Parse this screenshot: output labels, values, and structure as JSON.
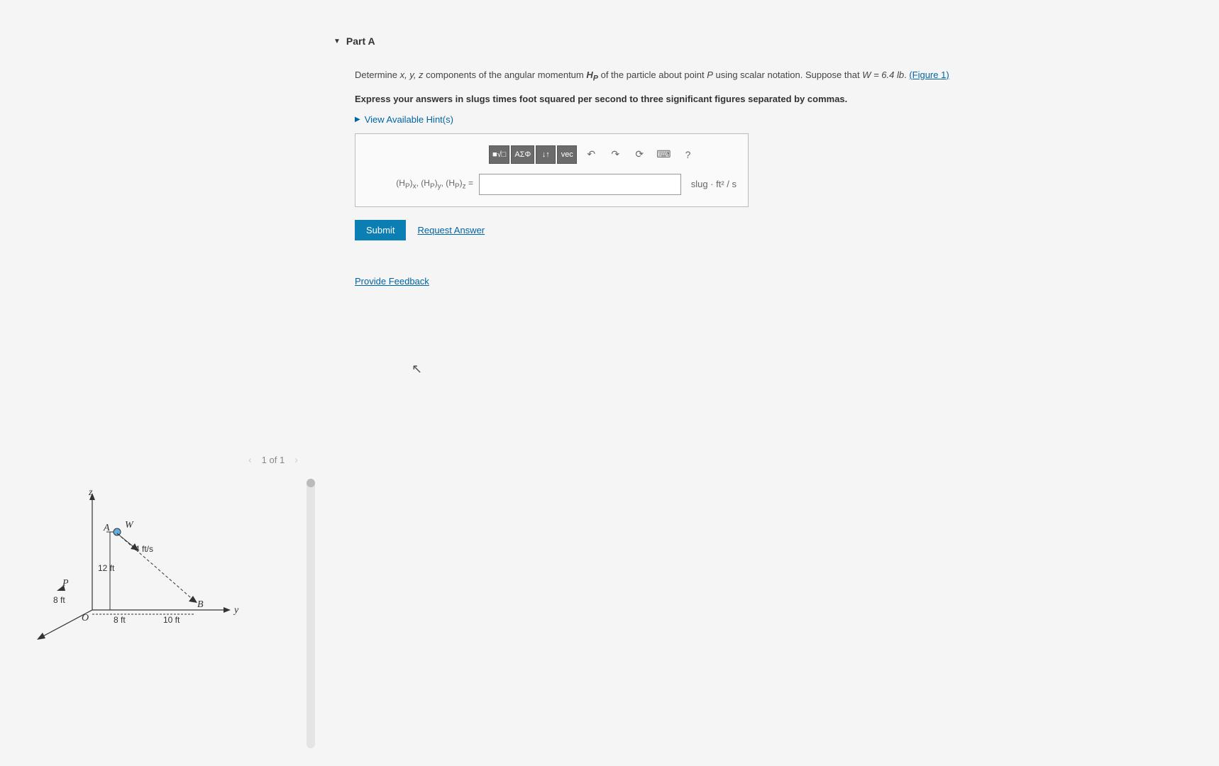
{
  "part": {
    "title": "Part A"
  },
  "question": {
    "prefix": "Determine ",
    "vars": "x, y, z",
    "mid": " components of the angular momentum ",
    "hp": "H_P",
    "mid2": " of the particle about point ",
    "pointP": "P",
    "mid3": " using scalar notation. Suppose that ",
    "w_eq": "W = 6.4 lb",
    "suffix_dot": ". ",
    "figure_link": "(Figure 1)",
    "instruction": "Express your answers in slugs times foot squared per second to three significant figures separated by commas."
  },
  "hints": {
    "label": "View Available Hint(s)"
  },
  "toolbar": {
    "template": "■√□",
    "greek": "ΑΣΦ",
    "subsup": "↓↑",
    "vec": "vec",
    "undo": "↶",
    "redo": "↷",
    "reset": "⟳",
    "keyboard": "⌨",
    "help": "?"
  },
  "answer": {
    "label_html": "(H_P)_x, (H_P)_y, (H_P)_z =",
    "value": "",
    "placeholder": "",
    "units": "slug · ft² / s"
  },
  "buttons": {
    "submit": "Submit",
    "request_answer": "Request Answer"
  },
  "feedback": "Provide Feedback",
  "figure_nav": {
    "prev": "‹",
    "label": "1 of 1",
    "next": "›"
  },
  "diagram": {
    "z": "z",
    "y": "y",
    "A": "A",
    "W": "W",
    "B": "B",
    "P": "P",
    "O": "O",
    "vel": "4 ft/s",
    "h": "12 ft",
    "px": "8 ft",
    "ox": "8 ft",
    "oy": "10 ft"
  }
}
